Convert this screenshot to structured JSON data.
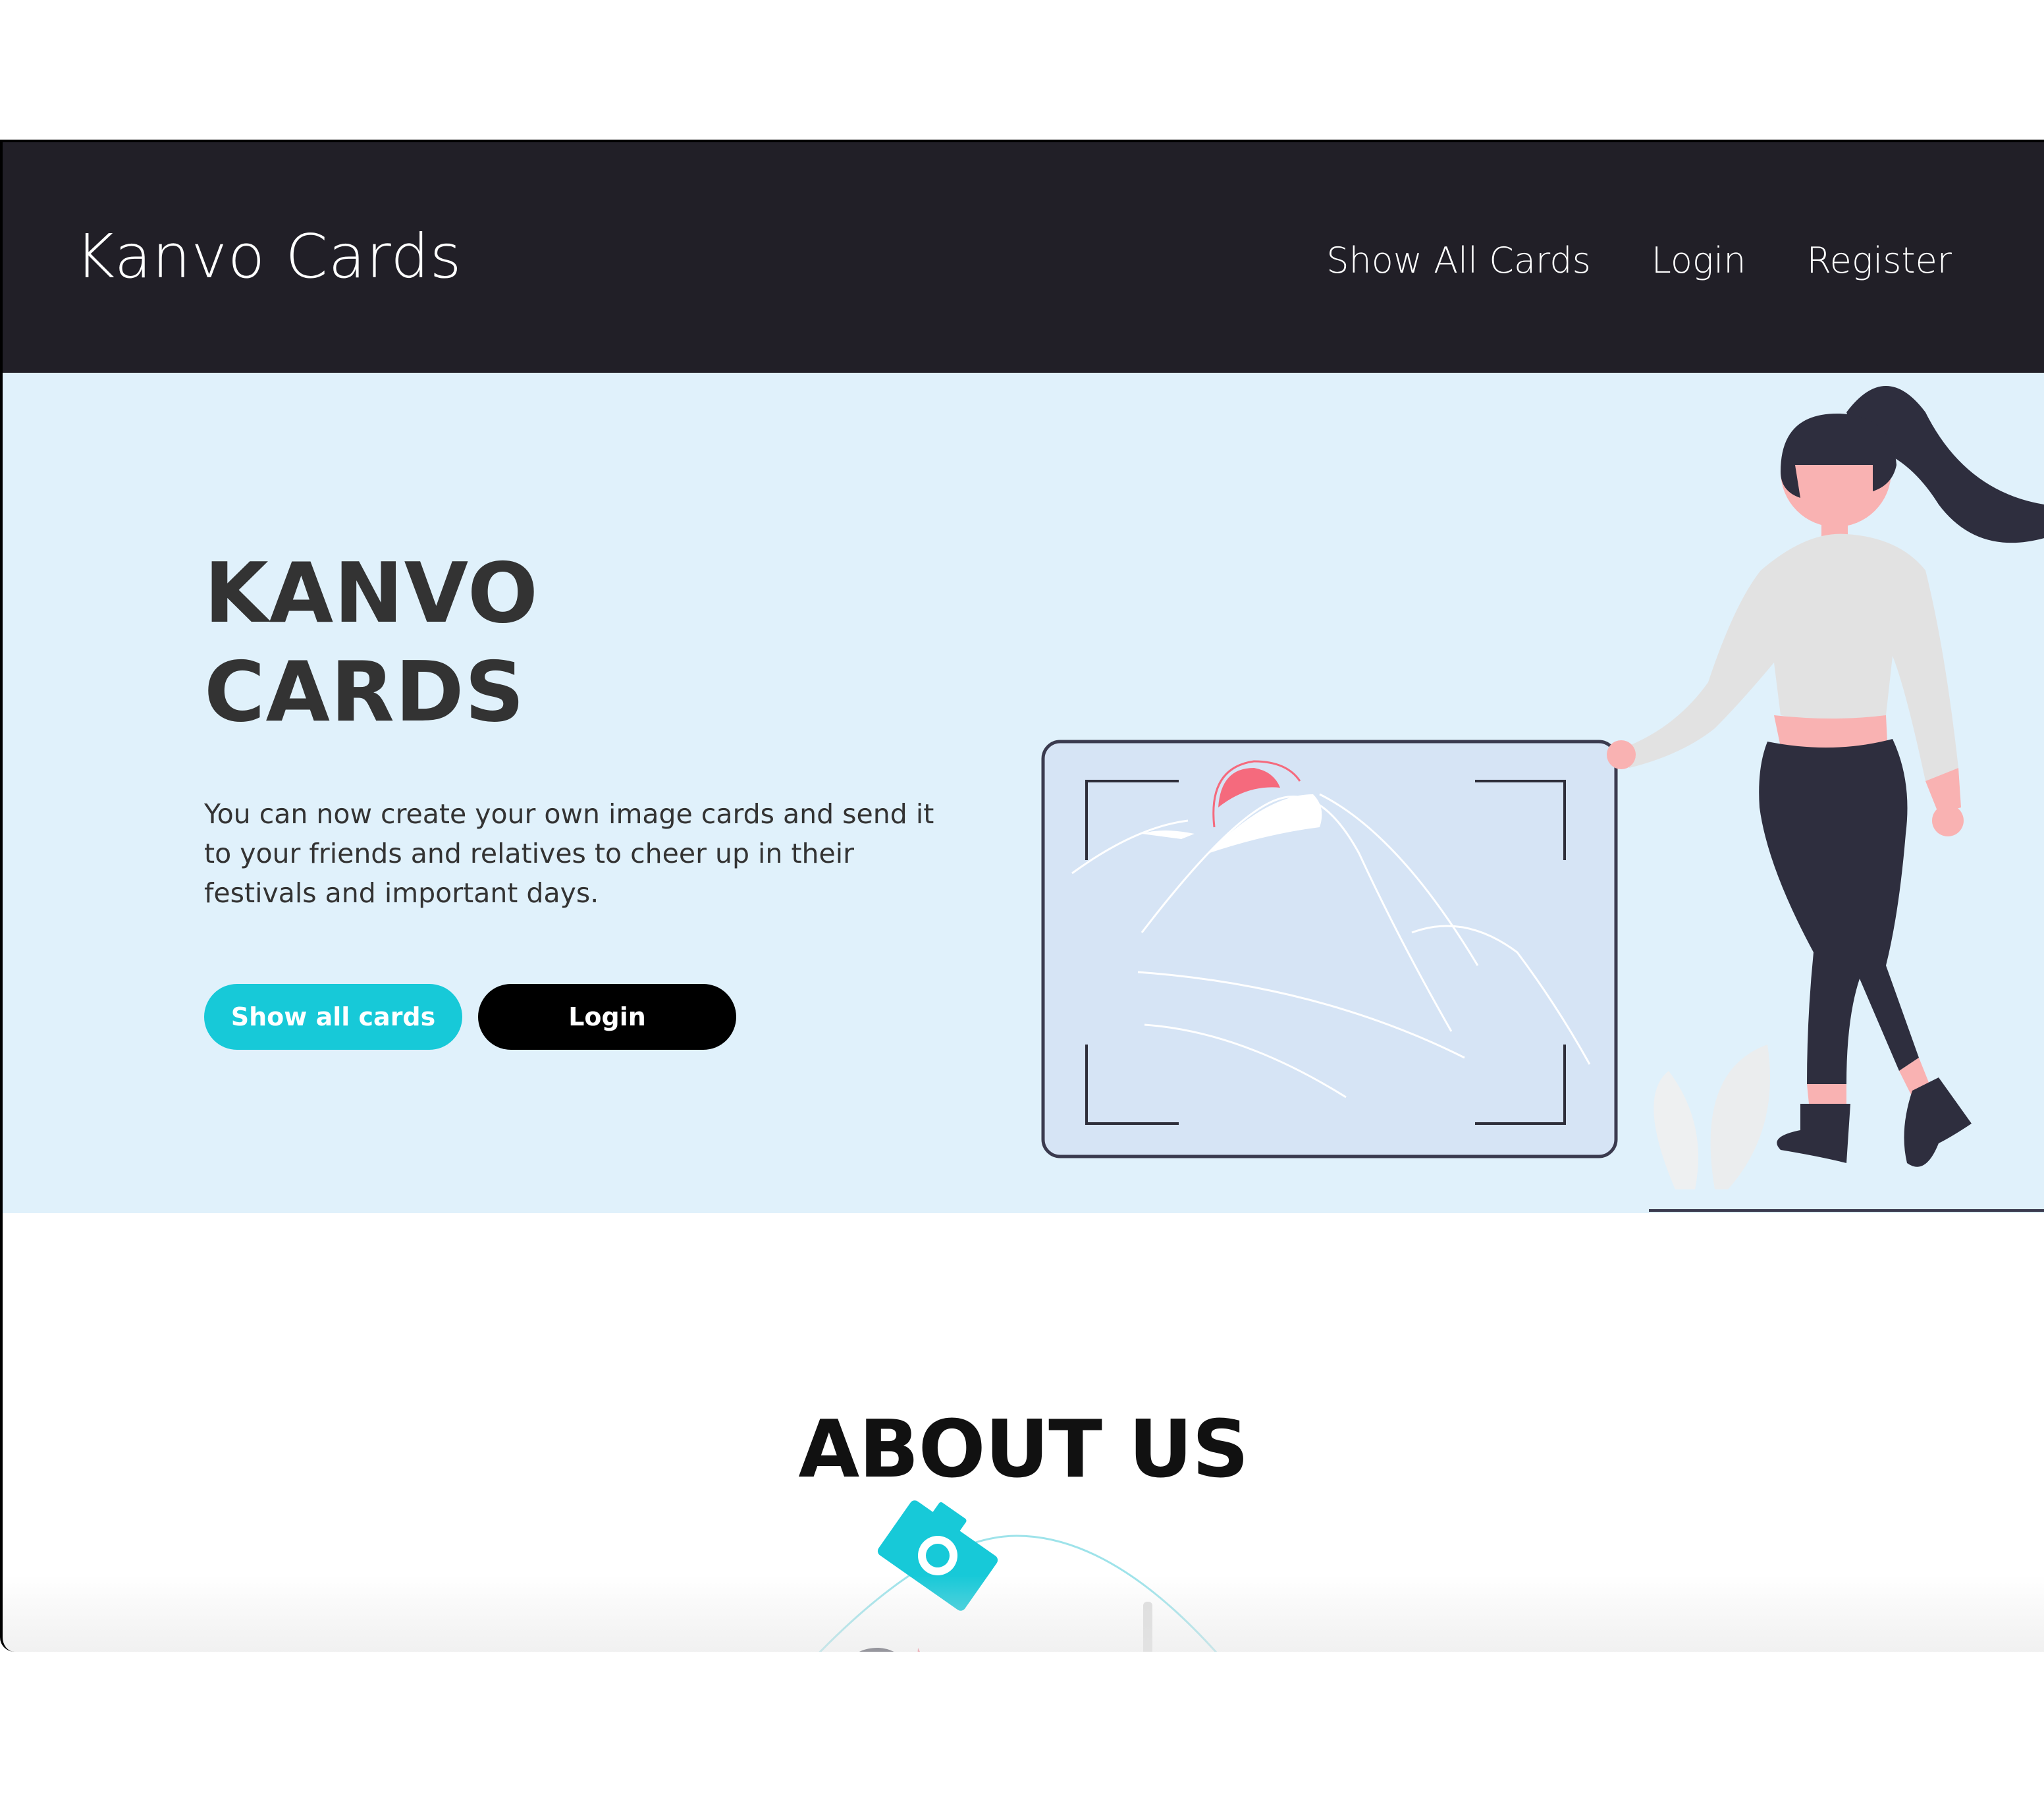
{
  "navbar": {
    "brand": "Kanvo Cards",
    "links": [
      "Show All Cards",
      "Login",
      "Register"
    ]
  },
  "hero": {
    "title_line1": "KANVO",
    "title_line2": "CARDS",
    "description": "You can now create your own image cards and send it to your friends and relatives to cheer up in their festivals and important days.",
    "primary_button": "Show all cards",
    "secondary_button": "Login",
    "illustration": "woman-with-image-card-illustration"
  },
  "about": {
    "title": "ABOUT US",
    "illustration": "camera-illustration"
  },
  "colors": {
    "navbar_bg": "#211f27",
    "hero_bg": "#e0f1fb",
    "accent": "#17c9d8",
    "pink": "#f56a7d",
    "dark_text": "#333333"
  }
}
